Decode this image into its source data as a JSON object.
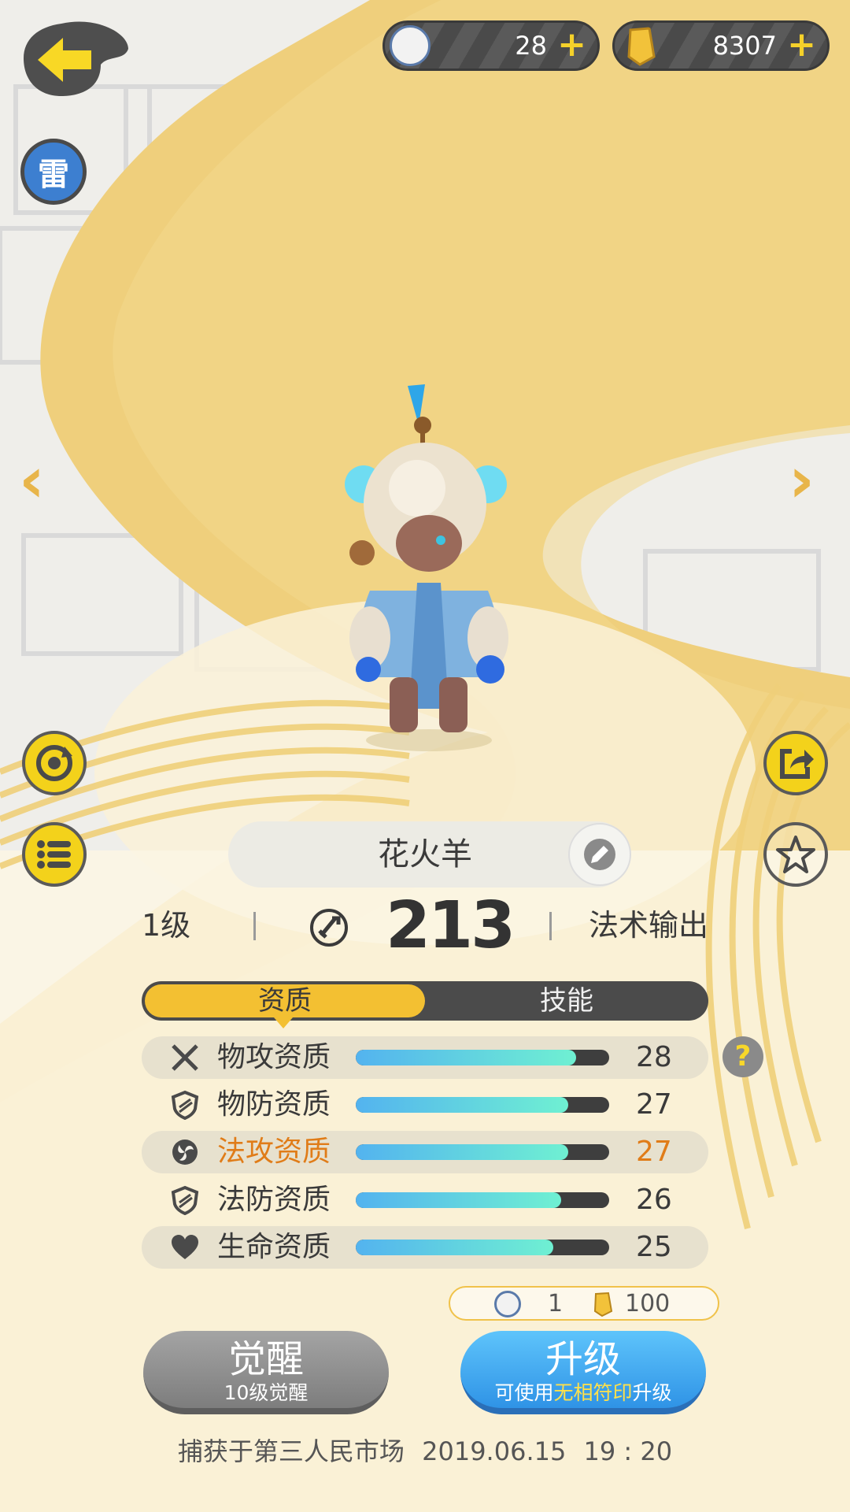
{
  "element": {
    "label": "雷"
  },
  "currencies": [
    {
      "icon": "sheep-token-icon",
      "value": "28"
    },
    {
      "icon": "gold-crystal-icon",
      "value": "8307"
    }
  ],
  "pet": {
    "name": "花火羊",
    "level": "1级",
    "power": "213",
    "role": "法术输出"
  },
  "tabs": [
    {
      "label": "资质",
      "active": true
    },
    {
      "label": "技能",
      "active": false
    }
  ],
  "attributes": [
    {
      "icon": "physical-attack-icon",
      "label": "物攻资质",
      "value": "28",
      "fill": 0.87,
      "highlight": false
    },
    {
      "icon": "physical-defense-icon",
      "label": "物防资质",
      "value": "27",
      "fill": 0.84,
      "highlight": false
    },
    {
      "icon": "magic-attack-icon",
      "label": "法攻资质",
      "value": "27",
      "fill": 0.84,
      "highlight": true
    },
    {
      "icon": "magic-defense-icon",
      "label": "法防资质",
      "value": "26",
      "fill": 0.81,
      "highlight": false
    },
    {
      "icon": "heart-icon",
      "label": "生命资质",
      "value": "25",
      "fill": 0.78,
      "highlight": false
    }
  ],
  "cost": {
    "token_count": "1",
    "gold_count": "100"
  },
  "buttons": {
    "awaken_label": "觉醒",
    "awaken_sub": "10级觉醒",
    "upgrade_label": "升级",
    "upgrade_sub_prefix": "可使用",
    "upgrade_sub_highlight": "无相符印",
    "upgrade_sub_suffix": "升级"
  },
  "footer": {
    "location": "捕获于第三人民市场",
    "date": "2019.06.15",
    "time": "19 : 20"
  },
  "colors": {
    "accent_yellow": "#f3c032",
    "highlight_orange": "#e07c18",
    "upgrade_blue": "#3fa8f0"
  }
}
